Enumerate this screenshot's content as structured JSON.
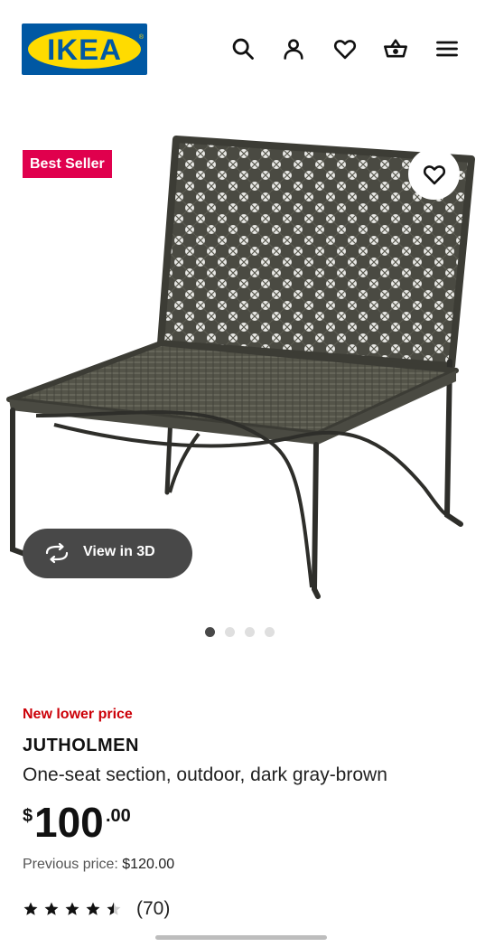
{
  "header": {
    "logo_text": "IKEA",
    "icons": [
      "search-icon",
      "account-icon",
      "favourites-icon",
      "basket-icon",
      "menu-icon"
    ]
  },
  "gallery": {
    "badge": "Best Seller",
    "view_3d_label": "View in 3D",
    "current_slide": 1,
    "slides": 4
  },
  "product": {
    "price_tag": "New lower price",
    "name": "JUTHOLMEN",
    "description": "One-seat section, outdoor, dark gray-brown",
    "price_currency": "$",
    "price_integer": "100",
    "price_decimal": ".00",
    "previous_price_label": "Previous price:",
    "previous_price_value": "$120.00",
    "rating_value": 4.5,
    "rating_count": "(70)"
  },
  "colors": {
    "ikea_blue": "#0058a3",
    "ikea_yellow": "#ffdb00",
    "badge_red": "#e0004d",
    "price_tag_red": "#cc0008"
  }
}
